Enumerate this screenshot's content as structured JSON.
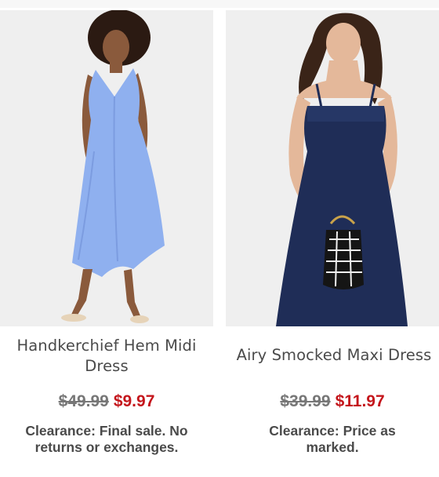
{
  "products": [
    {
      "title_line1": "Handkerchief Hem Midi",
      "title_line2": "Dress",
      "was_price": "$49.99",
      "sale_price": "$9.97",
      "note_line1": "Clearance: Final sale. No",
      "note_line2": "returns or exchanges.",
      "dress_color": "#8fb0ef"
    },
    {
      "title_line1": "Airy Smocked Maxi Dress",
      "was_price": "$39.99",
      "sale_price": "$11.97",
      "note_line1": "Clearance: Price as",
      "note_line2": "marked.",
      "dress_color": "#1f2d57"
    }
  ],
  "colors": {
    "sale_red": "#c4161c",
    "text_gray": "#4a4a4a",
    "strike_gray": "#777777",
    "photo_bg": "#efefef"
  }
}
